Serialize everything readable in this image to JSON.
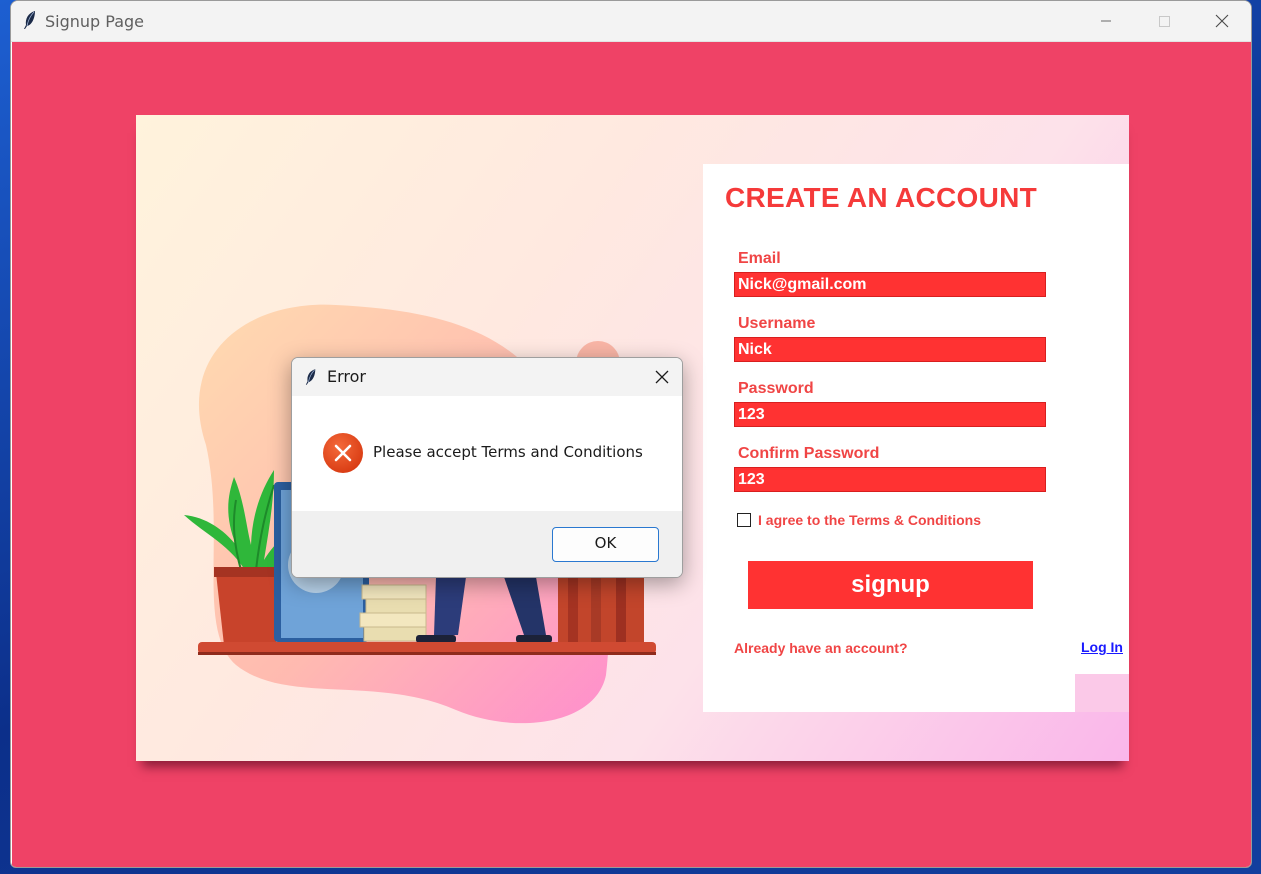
{
  "window": {
    "title": "Signup Page"
  },
  "form": {
    "title": "CREATE AN ACCOUNT",
    "email_label": "Email",
    "email_value": "Nick@gmail.com",
    "username_label": "Username",
    "username_value": "Nick",
    "password_label": "Password",
    "password_value": "123",
    "confirm_label": "Confirm Password",
    "confirm_value": "123",
    "terms_label": "I agree to the Terms & Conditions",
    "terms_checked": false,
    "signup_label": "signup",
    "have_account_text": "Already have an account?",
    "login_link": "Log In"
  },
  "dialog": {
    "title": "Error",
    "message": "Please accept Terms and Conditions",
    "ok_label": "OK"
  },
  "colors": {
    "background": "#ef4266",
    "accent": "#ff3232",
    "label": "#f04545",
    "link": "#1a1aff",
    "error_icon": "#e8481d"
  }
}
